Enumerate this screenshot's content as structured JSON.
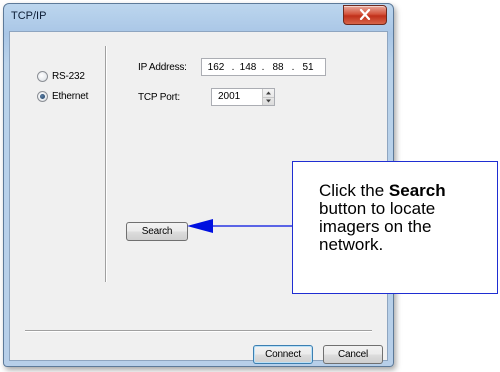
{
  "window": {
    "title": "TCP/IP"
  },
  "connection": {
    "rs232_label": "RS-232",
    "ethernet_label": "Ethernet",
    "selected": "Ethernet"
  },
  "ip": {
    "label": "IP Address:",
    "octets": [
      "162",
      "148",
      "88",
      "51"
    ]
  },
  "port": {
    "label": "TCP Port:",
    "value": "2001"
  },
  "buttons": {
    "search": "Search",
    "connect": "Connect",
    "cancel": "Cancel"
  },
  "callout": {
    "prefix": "Click the ",
    "bold": "Search",
    "suffix": " button to locate imagers on the network."
  },
  "colors": {
    "callout_border": "#1f2ed2",
    "arrow": "#0010e0"
  }
}
